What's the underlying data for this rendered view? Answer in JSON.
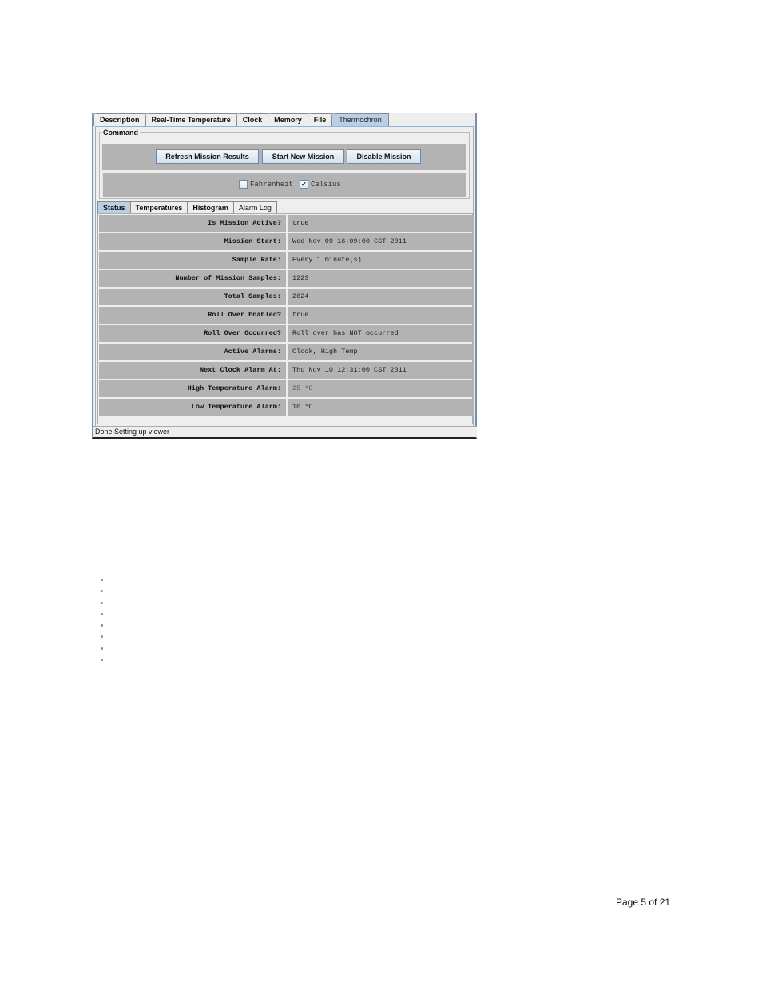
{
  "window": {
    "tabs": [
      {
        "label": "Description",
        "active": false
      },
      {
        "label": "Real-Time Temperature",
        "active": false
      },
      {
        "label": "Clock",
        "active": false
      },
      {
        "label": "Memory",
        "active": false
      },
      {
        "label": "File",
        "active": false
      },
      {
        "label": "Thermochron",
        "active": true
      }
    ],
    "command": {
      "legend": "Command",
      "buttons": {
        "refresh": "Refresh Mission Results",
        "start": "Start New Mission",
        "disable": "Disable Mission"
      },
      "units": {
        "fahrenheit": {
          "label": "Fahrenheit",
          "checked": false
        },
        "celsius": {
          "label": "Celsius",
          "checked": true
        }
      }
    },
    "subtabs": [
      {
        "label": "Status",
        "active": true
      },
      {
        "label": "Temperatures",
        "active": false
      },
      {
        "label": "Histogram",
        "active": false
      },
      {
        "label": "Alarm Log",
        "active": false
      }
    ],
    "status_rows": [
      {
        "key": "Is Mission Active?",
        "value": "true"
      },
      {
        "key": "Mission Start:",
        "value": "Wed Nov 09 16:09:00 CST 2011"
      },
      {
        "key": "Sample Rate:",
        "value": "Every 1 minute(s)"
      },
      {
        "key": "Number of Mission Samples:",
        "value": "1223"
      },
      {
        "key": "Total Samples:",
        "value": "2624"
      },
      {
        "key": "Roll Over Enabled?",
        "value": "true"
      },
      {
        "key": "Roll Over Occurred?",
        "value": "Roll over has NOT occurred"
      },
      {
        "key": "Active Alarms:",
        "value": "Clock, High Temp"
      },
      {
        "key": "Next Clock Alarm At:",
        "value": "Thu Nov 10 12:31:00 CST 2011"
      },
      {
        "key": "High Temperature Alarm:",
        "value": "25 °C"
      },
      {
        "key": "Low Temperature Alarm:",
        "value": "10 °C"
      }
    ],
    "statusbar": "Done Setting up viewer"
  },
  "document": {
    "bullet_count": 8,
    "page_number": "Page 5 of 21"
  },
  "colors": {
    "active_tab": "#b8cfe5",
    "panel_gray": "#b3b3b3",
    "window_bg": "#eeeeee",
    "button_border": "#6e88a6"
  }
}
